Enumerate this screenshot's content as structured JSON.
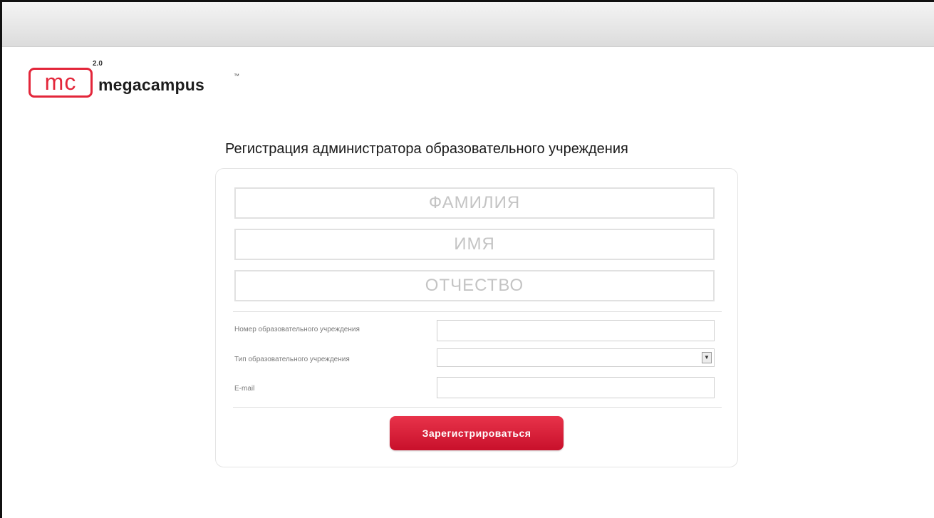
{
  "logo": {
    "mark": "mc",
    "wordmark": "megacampus",
    "version": "2.0",
    "tm": "™"
  },
  "form": {
    "title": "Регистрация администратора образовательного учреждения",
    "last_name_placeholder": "ФАМИЛИЯ",
    "first_name_placeholder": "ИМЯ",
    "middle_name_placeholder": "ОТЧЕСТВО",
    "institution_number_label": "Номер образовательного учреждения",
    "institution_number_value": "",
    "institution_type_label": "Тип образовательного учреждения",
    "institution_type_value": "",
    "email_label": "E-mail",
    "email_value": "",
    "submit_label": "Зарегистрироваться"
  },
  "colors": {
    "brand": "#e3263a",
    "button": "#d61a35"
  },
  "icons": {
    "select_arrow": "chevron-down-icon"
  }
}
